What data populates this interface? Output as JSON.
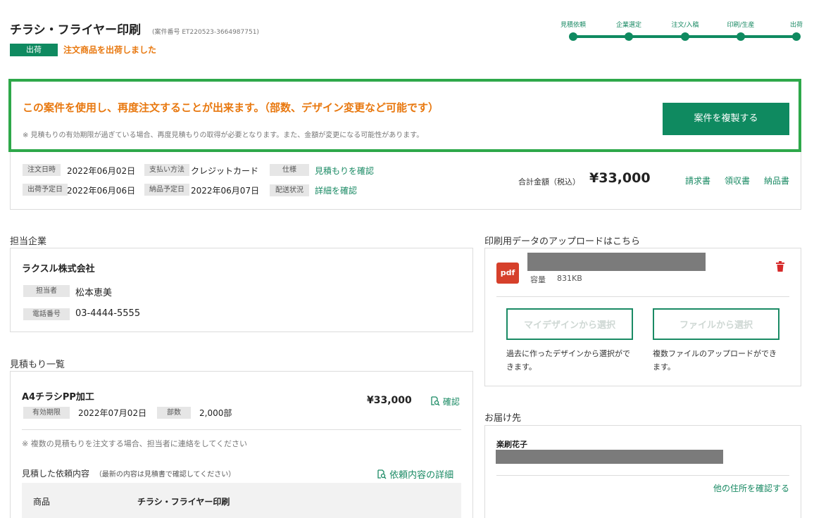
{
  "header": {
    "title": "チラシ・フライヤー印刷",
    "case_number": "(案件番号 ET220523-3664987751)",
    "status_badge": "出荷",
    "status_message": "注文商品を出荷しました"
  },
  "progress": {
    "steps": [
      "見積依頼",
      "企業選定",
      "注文/入稿",
      "印刷/生産",
      "出荷"
    ],
    "current_step": 5
  },
  "reorder": {
    "headline": "この案件を使用し、再度注文することが出来ます。（部数、デザイン変更など可能です）",
    "note": "※ 見積もりの有効期限が過ぎている場合、再度見積もりの取得が必要となります。また、金額が変更になる可能性があります。",
    "button": "案件を複製する"
  },
  "order_summary": {
    "order_date_label": "注文日時",
    "order_date": "2022年06月02日",
    "payment_label": "支払い方法",
    "payment": "クレジットカード",
    "spec_label": "仕様",
    "spec_link": "見積もりを確認",
    "ship_date_label": "出荷予定日",
    "ship_date": "2022年06月06日",
    "delivery_date_label": "納品予定日",
    "delivery_date": "2022年06月07日",
    "shipping_status_label": "配送状況",
    "shipping_status_link": "詳細を確認",
    "total_label": "合計金額（税込）",
    "total": "¥33,000",
    "links": [
      "請求書",
      "領収書",
      "納品書"
    ]
  },
  "company": {
    "section_title": "担当企業",
    "name": "ラクスル株式会社",
    "contact_label": "担当者",
    "contact": "松本恵美",
    "phone_label": "電話番号",
    "phone": "03-4444-5555"
  },
  "upload": {
    "section_title": "印刷用データのアップロードはこちら",
    "file_icon": "pdf",
    "size_label": "容量",
    "size": "831KB",
    "my_design_button": "マイデザインから選択",
    "my_design_desc": "過去に作ったデザインから選択ができます。",
    "file_button": "ファイルから選択",
    "file_desc": "複数ファイルのアップロードができます。"
  },
  "estimates": {
    "section_title": "見積もり一覧",
    "item_name": "A4チラシPP加工",
    "expiry_label": "有効期限",
    "expiry": "2022年07月02日",
    "quantity_label": "部数",
    "quantity": "2,000部",
    "price": "¥33,000",
    "confirm_link": "確認",
    "note": "※ 複数の見積もりを注文する場合、担当者に連絡をしてください",
    "request_title": "見積した依頼内容",
    "request_hint": "（最新の内容は見積書で確認してください）",
    "request_detail_link": "依頼内容の詳細",
    "product_label": "商品",
    "product_value": "チラシ・フライヤー印刷"
  },
  "delivery": {
    "section_title": "お届け先",
    "recipient": "楽刷花子",
    "other_address_link": "他の住所を確認する"
  },
  "colors": {
    "brand_green": "#0f8a60",
    "accent_orange": "#e8780f",
    "highlight_border": "#2ea84a",
    "pdf_red": "#d6402b"
  }
}
